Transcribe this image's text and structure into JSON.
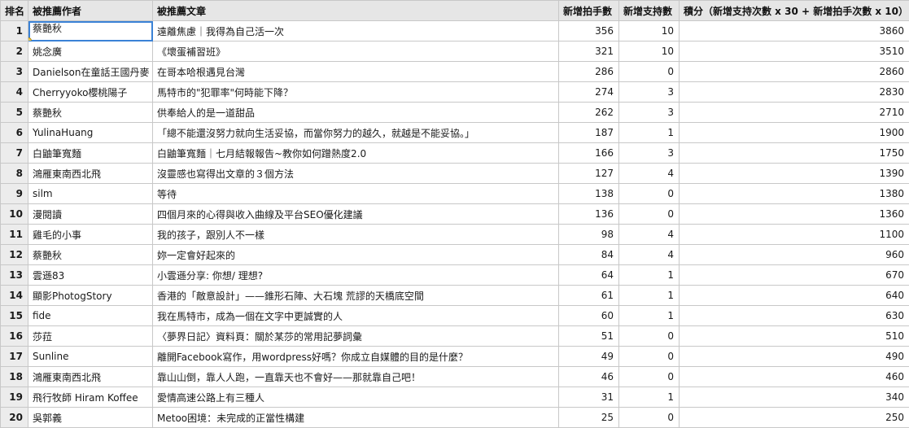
{
  "headers": {
    "rank": "排名",
    "author": "被推薦作者",
    "article": "被推薦文章",
    "claps": "新增拍手數",
    "support": "新增支持數",
    "score": "積分（新增支持次數 x 30 + 新增拍手次數 x 10）"
  },
  "rows": [
    {
      "rank": "1",
      "author": "蔡艷秋",
      "article": "遠離焦慮｜我得為自己活一次",
      "claps": "356",
      "support": "10",
      "score": "3860"
    },
    {
      "rank": "2",
      "author": "姚念廣",
      "article": "《壞蛋補習班》",
      "claps": "321",
      "support": "10",
      "score": "3510"
    },
    {
      "rank": "3",
      "author": "Danielson在童話王國丹麥",
      "article": "在哥本哈根遇見台灣",
      "claps": "286",
      "support": "0",
      "score": "2860"
    },
    {
      "rank": "4",
      "author": "Cherryyoko櫻桃陽子",
      "article": "馬特市的\"犯罪率\"何時能下降？",
      "claps": "274",
      "support": "3",
      "score": "2830"
    },
    {
      "rank": "5",
      "author": "蔡艷秋",
      "article": "供奉給人的是一道甜品",
      "claps": "262",
      "support": "3",
      "score": "2710"
    },
    {
      "rank": "6",
      "author": "YulinaHuang",
      "article": "「總不能還沒努力就向生活妥協，而當你努力的越久，就越是不能妥協。」",
      "claps": "187",
      "support": "1",
      "score": "1900"
    },
    {
      "rank": "7",
      "author": "白鼬筆寬麵",
      "article": "白鼬筆寬麵｜七月結報報告~教你如何蹭熱度2.0",
      "claps": "166",
      "support": "3",
      "score": "1750"
    },
    {
      "rank": "8",
      "author": "鴻雁東南西北飛",
      "article": "沒靈感也寫得出文章的３個方法",
      "claps": "127",
      "support": "4",
      "score": "1390"
    },
    {
      "rank": "9",
      "author": "silm",
      "article": "等待",
      "claps": "138",
      "support": "0",
      "score": "1380"
    },
    {
      "rank": "10",
      "author": "漫閱讀",
      "article": "四個月來的心得與收入曲線及平台SEO優化建議",
      "claps": "136",
      "support": "0",
      "score": "1360"
    },
    {
      "rank": "11",
      "author": "雞毛的小事",
      "article": "我的孩子，跟別人不一樣",
      "claps": "98",
      "support": "4",
      "score": "1100"
    },
    {
      "rank": "12",
      "author": "蔡艷秋",
      "article": "妳一定會好起來的",
      "claps": "84",
      "support": "4",
      "score": "960"
    },
    {
      "rank": "13",
      "author": "雲遜83",
      "article": "小雲遜分享: 你想/ 理想?",
      "claps": "64",
      "support": "1",
      "score": "670"
    },
    {
      "rank": "14",
      "author": "顯影PhotogStory",
      "article": "香港的「敵意設計」——錐形石陣、大石塊 荒謬的天橋底空間",
      "claps": "61",
      "support": "1",
      "score": "640"
    },
    {
      "rank": "15",
      "author": "fide",
      "article": "我在馬特市，成為一個在文字中更誠實的人",
      "claps": "60",
      "support": "1",
      "score": "630"
    },
    {
      "rank": "16",
      "author": "莎菈",
      "article": "〈夢界日記〉資料頁：關於某莎的常用記夢詞彙",
      "claps": "51",
      "support": "0",
      "score": "510"
    },
    {
      "rank": "17",
      "author": "Sunline",
      "article": "離開Facebook寫作，用wordpress好嗎？你成立自媒體的目的是什麼？",
      "claps": "49",
      "support": "0",
      "score": "490"
    },
    {
      "rank": "18",
      "author": "鴻雁東南西北飛",
      "article": "靠山山倒，靠人人跑，一直靠天也不會好——那就靠自己吧！",
      "claps": "46",
      "support": "0",
      "score": "460"
    },
    {
      "rank": "19",
      "author": "飛行牧師 Hiram Koffee",
      "article": "愛情高速公路上有三種人",
      "claps": "31",
      "support": "1",
      "score": "340"
    },
    {
      "rank": "20",
      "author": "吳郭義",
      "article": "Metoo困境：未完成的正當性構建",
      "claps": "25",
      "support": "0",
      "score": "250"
    }
  ]
}
